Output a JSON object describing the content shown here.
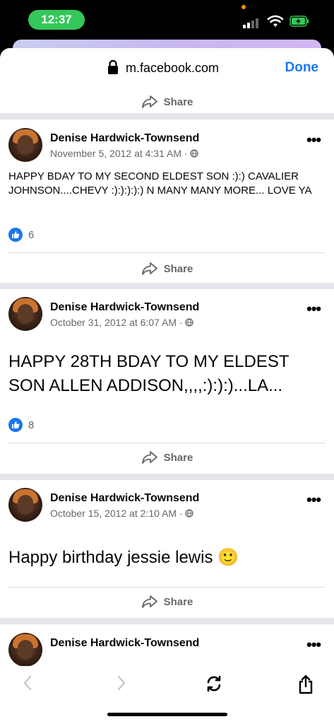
{
  "status": {
    "time": "12:37"
  },
  "browser": {
    "url": "m.facebook.com",
    "done_label": "Done"
  },
  "share_label": "Share",
  "posts": [
    {
      "author": "Denise Hardwick-Townsend",
      "date": "November 5, 2012 at 4:31 AM",
      "text": "HAPPY BDAY TO MY SECOND ELDEST SON :):) CAVALIER JOHNSON....CHEVY :):):):):) N MANY MANY MORE... LOVE YA",
      "likes": "6"
    },
    {
      "author": "Denise Hardwick-Townsend",
      "date": "October 31, 2012 at 6:07 AM",
      "text": "HAPPY 28TH BDAY TO MY ELDEST SON ALLEN ADDISON,,,,:):):)...LA...",
      "likes": "8"
    },
    {
      "author": "Denise Hardwick-Townsend",
      "date": "October 15, 2012 at 2:10 AM",
      "text": "Happy birthday jessie lewis 🙂"
    },
    {
      "author": "Denise Hardwick-Townsend"
    }
  ],
  "icons": {
    "lock": "lock-icon",
    "share": "share-arrow-icon",
    "globe": "globe-icon",
    "more": "more-options-icon",
    "like": "like-thumb-icon",
    "back": "back-chevron-icon",
    "forward": "forward-chevron-icon",
    "refresh": "refresh-icon",
    "share_sheet": "share-sheet-icon"
  },
  "colors": {
    "accent": "#1877f2",
    "status_pill": "#34c759",
    "muted": "#65676b"
  }
}
